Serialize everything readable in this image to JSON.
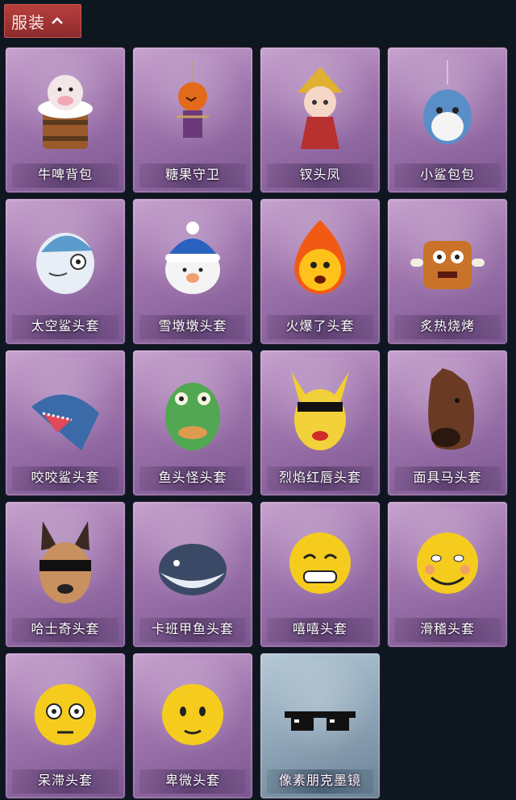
{
  "header": {
    "title": "服装"
  },
  "items": [
    {
      "label": "牛啤背包",
      "icon": "cow-beer-backpack-icon"
    },
    {
      "label": "糖果守卫",
      "icon": "pumpkin-scarecrow-icon"
    },
    {
      "label": "钗头凤",
      "icon": "phoenix-crown-doll-icon"
    },
    {
      "label": "小鲨包包",
      "icon": "shark-bag-icon"
    },
    {
      "label": "太空鲨头套",
      "icon": "space-shark-mask-icon"
    },
    {
      "label": "雪墩墩头套",
      "icon": "snowman-mask-icon"
    },
    {
      "label": "火爆了头套",
      "icon": "fire-mask-icon"
    },
    {
      "label": "炙热烧烤",
      "icon": "bbq-meat-mask-icon"
    },
    {
      "label": "咬咬鲨头套",
      "icon": "biting-shark-mask-icon"
    },
    {
      "label": "鱼头怪头套",
      "icon": "fish-head-mask-icon"
    },
    {
      "label": "烈焰红唇头套",
      "icon": "red-lips-pikachu-mask-icon"
    },
    {
      "label": "面具马头套",
      "icon": "horse-mask-icon"
    },
    {
      "label": "哈士奇头套",
      "icon": "husky-mask-icon"
    },
    {
      "label": "卡班甲鱼头套",
      "icon": "fish-mask-icon"
    },
    {
      "label": "嘻嘻头套",
      "icon": "grin-emoji-mask-icon"
    },
    {
      "label": "滑稽头套",
      "icon": "smirk-emoji-mask-icon"
    },
    {
      "label": "呆滞头套",
      "icon": "stunned-emoji-mask-icon"
    },
    {
      "label": "卑微头套",
      "icon": "humble-emoji-mask-icon"
    },
    {
      "label": "像素朋克墨镜",
      "icon": "pixel-sunglasses-icon",
      "variant": "special"
    }
  ],
  "colors": {
    "background": "#0e1620",
    "header": "#a83636",
    "card_purple": "#9f74ad",
    "card_blue": "#8fa6b8"
  }
}
